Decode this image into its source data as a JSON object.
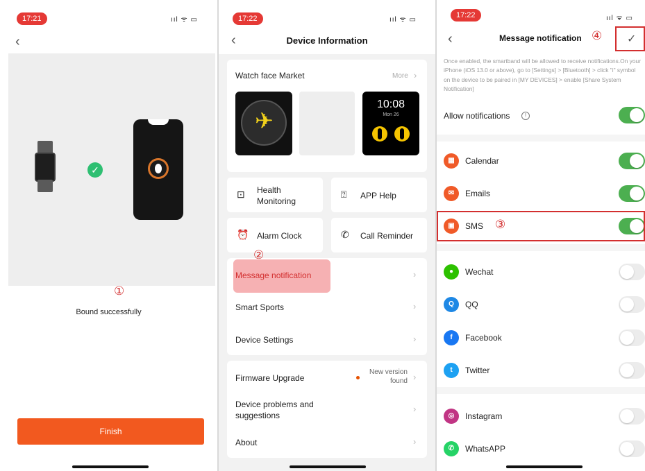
{
  "panel1": {
    "time": "17:21",
    "status": "ııl ᯤ ▭",
    "back_glyph": "‹",
    "step_marker": "①",
    "bound_text": "Bound successfully",
    "finish_label": "Finish"
  },
  "panel2": {
    "time": "17:22",
    "status": "ııl ᯤ ▭",
    "back_glyph": "‹",
    "title": "Device Information",
    "watch_face_market": "Watch face Market",
    "more": "More",
    "watchface_time": "10:08",
    "watchface_date": "Mon 26",
    "health_monitoring": "Health Monitoring",
    "app_help": "APP Help",
    "alarm_clock": "Alarm Clock",
    "call_reminder": "Call Reminder",
    "step_marker": "②",
    "message_notification": "Message notification",
    "smart_sports": "Smart Sports",
    "device_settings": "Device Settings",
    "firmware_upgrade": "Firmware Upgrade",
    "new_version": "New version found",
    "device_problems": "Device problems and suggestions",
    "about": "About",
    "chevron": "›"
  },
  "panel3": {
    "time": "17:22",
    "status": "ııl ᯤ ▭",
    "back_glyph": "‹",
    "title": "Message notification",
    "step_marker_4": "④",
    "confirm_glyph": "✓",
    "description": "Once enabled, the smartband will be allowed to receive notifications.On your iPhone (iOS 13.0 or above), go to [Settings] > [Bluetooth] > click \"i\" symbol on the device to be paired in [MY DEVICES] > enable [Share System Notification]",
    "allow_notifications": "Allow notifications",
    "info_glyph": "!",
    "step_marker_3": "③",
    "apps": [
      {
        "name": "Calendar",
        "on": true,
        "color": "#f05a28",
        "glyph": "▦"
      },
      {
        "name": "Emails",
        "on": true,
        "color": "#f05a28",
        "glyph": "✉"
      },
      {
        "name": "SMS",
        "on": true,
        "color": "#f05a28",
        "glyph": "▣"
      },
      {
        "name": "Wechat",
        "on": false,
        "color": "#2dc100",
        "glyph": "●"
      },
      {
        "name": "QQ",
        "on": false,
        "color": "#1e88e5",
        "glyph": "Q"
      },
      {
        "name": "Facebook",
        "on": false,
        "color": "#1877f2",
        "glyph": "f"
      },
      {
        "name": "Twitter",
        "on": false,
        "color": "#1da1f2",
        "glyph": "t"
      },
      {
        "name": "Instagram",
        "on": false,
        "color": "#c13584",
        "glyph": "◎"
      },
      {
        "name": "WhatsAPP",
        "on": false,
        "color": "#25d366",
        "glyph": "✆"
      }
    ]
  }
}
